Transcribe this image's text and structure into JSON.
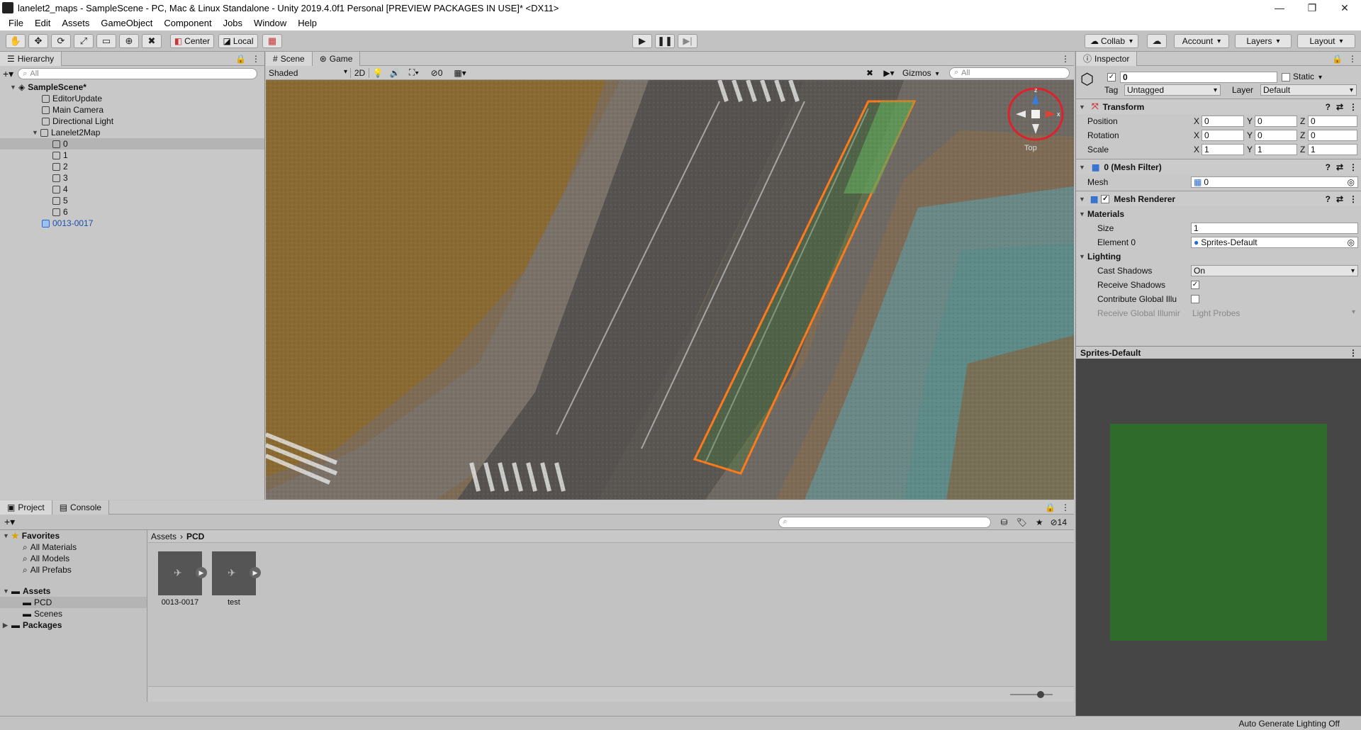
{
  "window": {
    "title": "lanelet2_maps - SampleScene - PC, Mac & Linux Standalone - Unity 2019.4.0f1 Personal [PREVIEW PACKAGES IN USE]* <DX11>",
    "minimize": "—",
    "maximize": "❐",
    "close": "✕"
  },
  "menu": [
    "File",
    "Edit",
    "Assets",
    "GameObject",
    "Component",
    "Jobs",
    "Window",
    "Help"
  ],
  "toolbar": {
    "pivot_label": "Center",
    "space_label": "Local",
    "collab_label": "Collab",
    "account_label": "Account",
    "layers_label": "Layers",
    "layout_label": "Layout"
  },
  "hierarchy": {
    "tab_label": "Hierarchy",
    "search_placeholder": "All",
    "scene_name": "SampleScene*",
    "items": [
      "EditorUpdate",
      "Main Camera",
      "Directional Light",
      "Lanelet2Map",
      "0",
      "1",
      "2",
      "3",
      "4",
      "5",
      "6",
      "0013-0017"
    ]
  },
  "scene": {
    "tab_scene": "Scene",
    "tab_game": "Game",
    "shading_mode": "Shaded",
    "mode_2d": "2D",
    "hidden_count": "0",
    "gizmos_label": "Gizmos",
    "search_placeholder": "All",
    "gizmo_axis_x": "x",
    "gizmo_axis_z": "z",
    "gizmo_label": "Top"
  },
  "inspector": {
    "tab_label": "Inspector",
    "object_name": "0",
    "static_label": "Static",
    "tag_label": "Tag",
    "tag_value": "Untagged",
    "layer_label": "Layer",
    "layer_value": "Default",
    "transform": {
      "title": "Transform",
      "position_label": "Position",
      "rotation_label": "Rotation",
      "scale_label": "Scale",
      "position": [
        "0",
        "0",
        "0"
      ],
      "rotation": [
        "0",
        "0",
        "0"
      ],
      "scale": [
        "1",
        "1",
        "1"
      ],
      "axis_x": "X",
      "axis_y": "Y",
      "axis_z": "Z"
    },
    "mesh_filter": {
      "title": "0 (Mesh Filter)",
      "mesh_label": "Mesh",
      "mesh_value": "0"
    },
    "mesh_renderer": {
      "title": "Mesh Renderer",
      "materials_label": "Materials",
      "size_label": "Size",
      "size_value": "1",
      "element_label": "Element 0",
      "element_value": "Sprites-Default",
      "lighting_label": "Lighting",
      "cast_shadows_label": "Cast Shadows",
      "cast_shadows_value": "On",
      "receive_shadows_label": "Receive Shadows",
      "contribute_gi_label": "Contribute Global Illu",
      "receive_gi_label": "Receive Global Illumir",
      "receive_gi_value": "Light Probes"
    },
    "preview_title": "Sprites-Default",
    "preview_color": "#2f6b2a"
  },
  "project": {
    "tab_project": "Project",
    "tab_console": "Console",
    "favorites_label": "Favorites",
    "favorites": [
      "All Materials",
      "All Models",
      "All Prefabs"
    ],
    "assets_label": "Assets",
    "asset_folders": [
      "PCD",
      "Scenes"
    ],
    "packages_label": "Packages",
    "breadcrumb_root": "Assets",
    "breadcrumb_current": "PCD",
    "hidden_packages_count": "14",
    "files": [
      "0013-0017",
      "test"
    ]
  },
  "status": {
    "lighting_text": "Auto Generate Lighting Off"
  },
  "colors": {
    "selection_outline": "#ff7a1a",
    "gizmo_highlight": "#e0202a",
    "road": "#55524e",
    "ground": "#8a6a3a",
    "water": "#5a8a88"
  }
}
